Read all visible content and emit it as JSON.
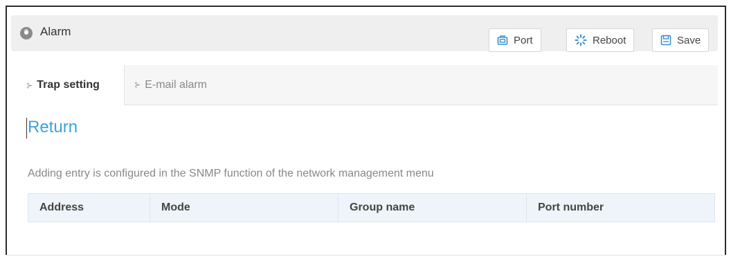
{
  "header": {
    "title": "Alarm",
    "title_icon": "location-pin-icon",
    "buttons": {
      "port": {
        "label": "Port",
        "icon": "port-icon"
      },
      "reboot": {
        "label": "Reboot",
        "icon": "reboot-icon"
      },
      "save": {
        "label": "Save",
        "icon": "save-icon"
      }
    }
  },
  "tabs": [
    {
      "label": "Trap setting",
      "active": true
    },
    {
      "label": "E-mail alarm",
      "active": false
    }
  ],
  "content": {
    "return_label": "Return",
    "note": "Adding entry is configured in the SNMP function of the network management menu",
    "table": {
      "columns": [
        "Address",
        "Mode",
        "Group name",
        "Port number"
      ],
      "rows": []
    }
  },
  "colors": {
    "accent": "#3aa3d8",
    "titlebar_bg": "#efefef",
    "table_header_bg": "#eef4fa"
  }
}
